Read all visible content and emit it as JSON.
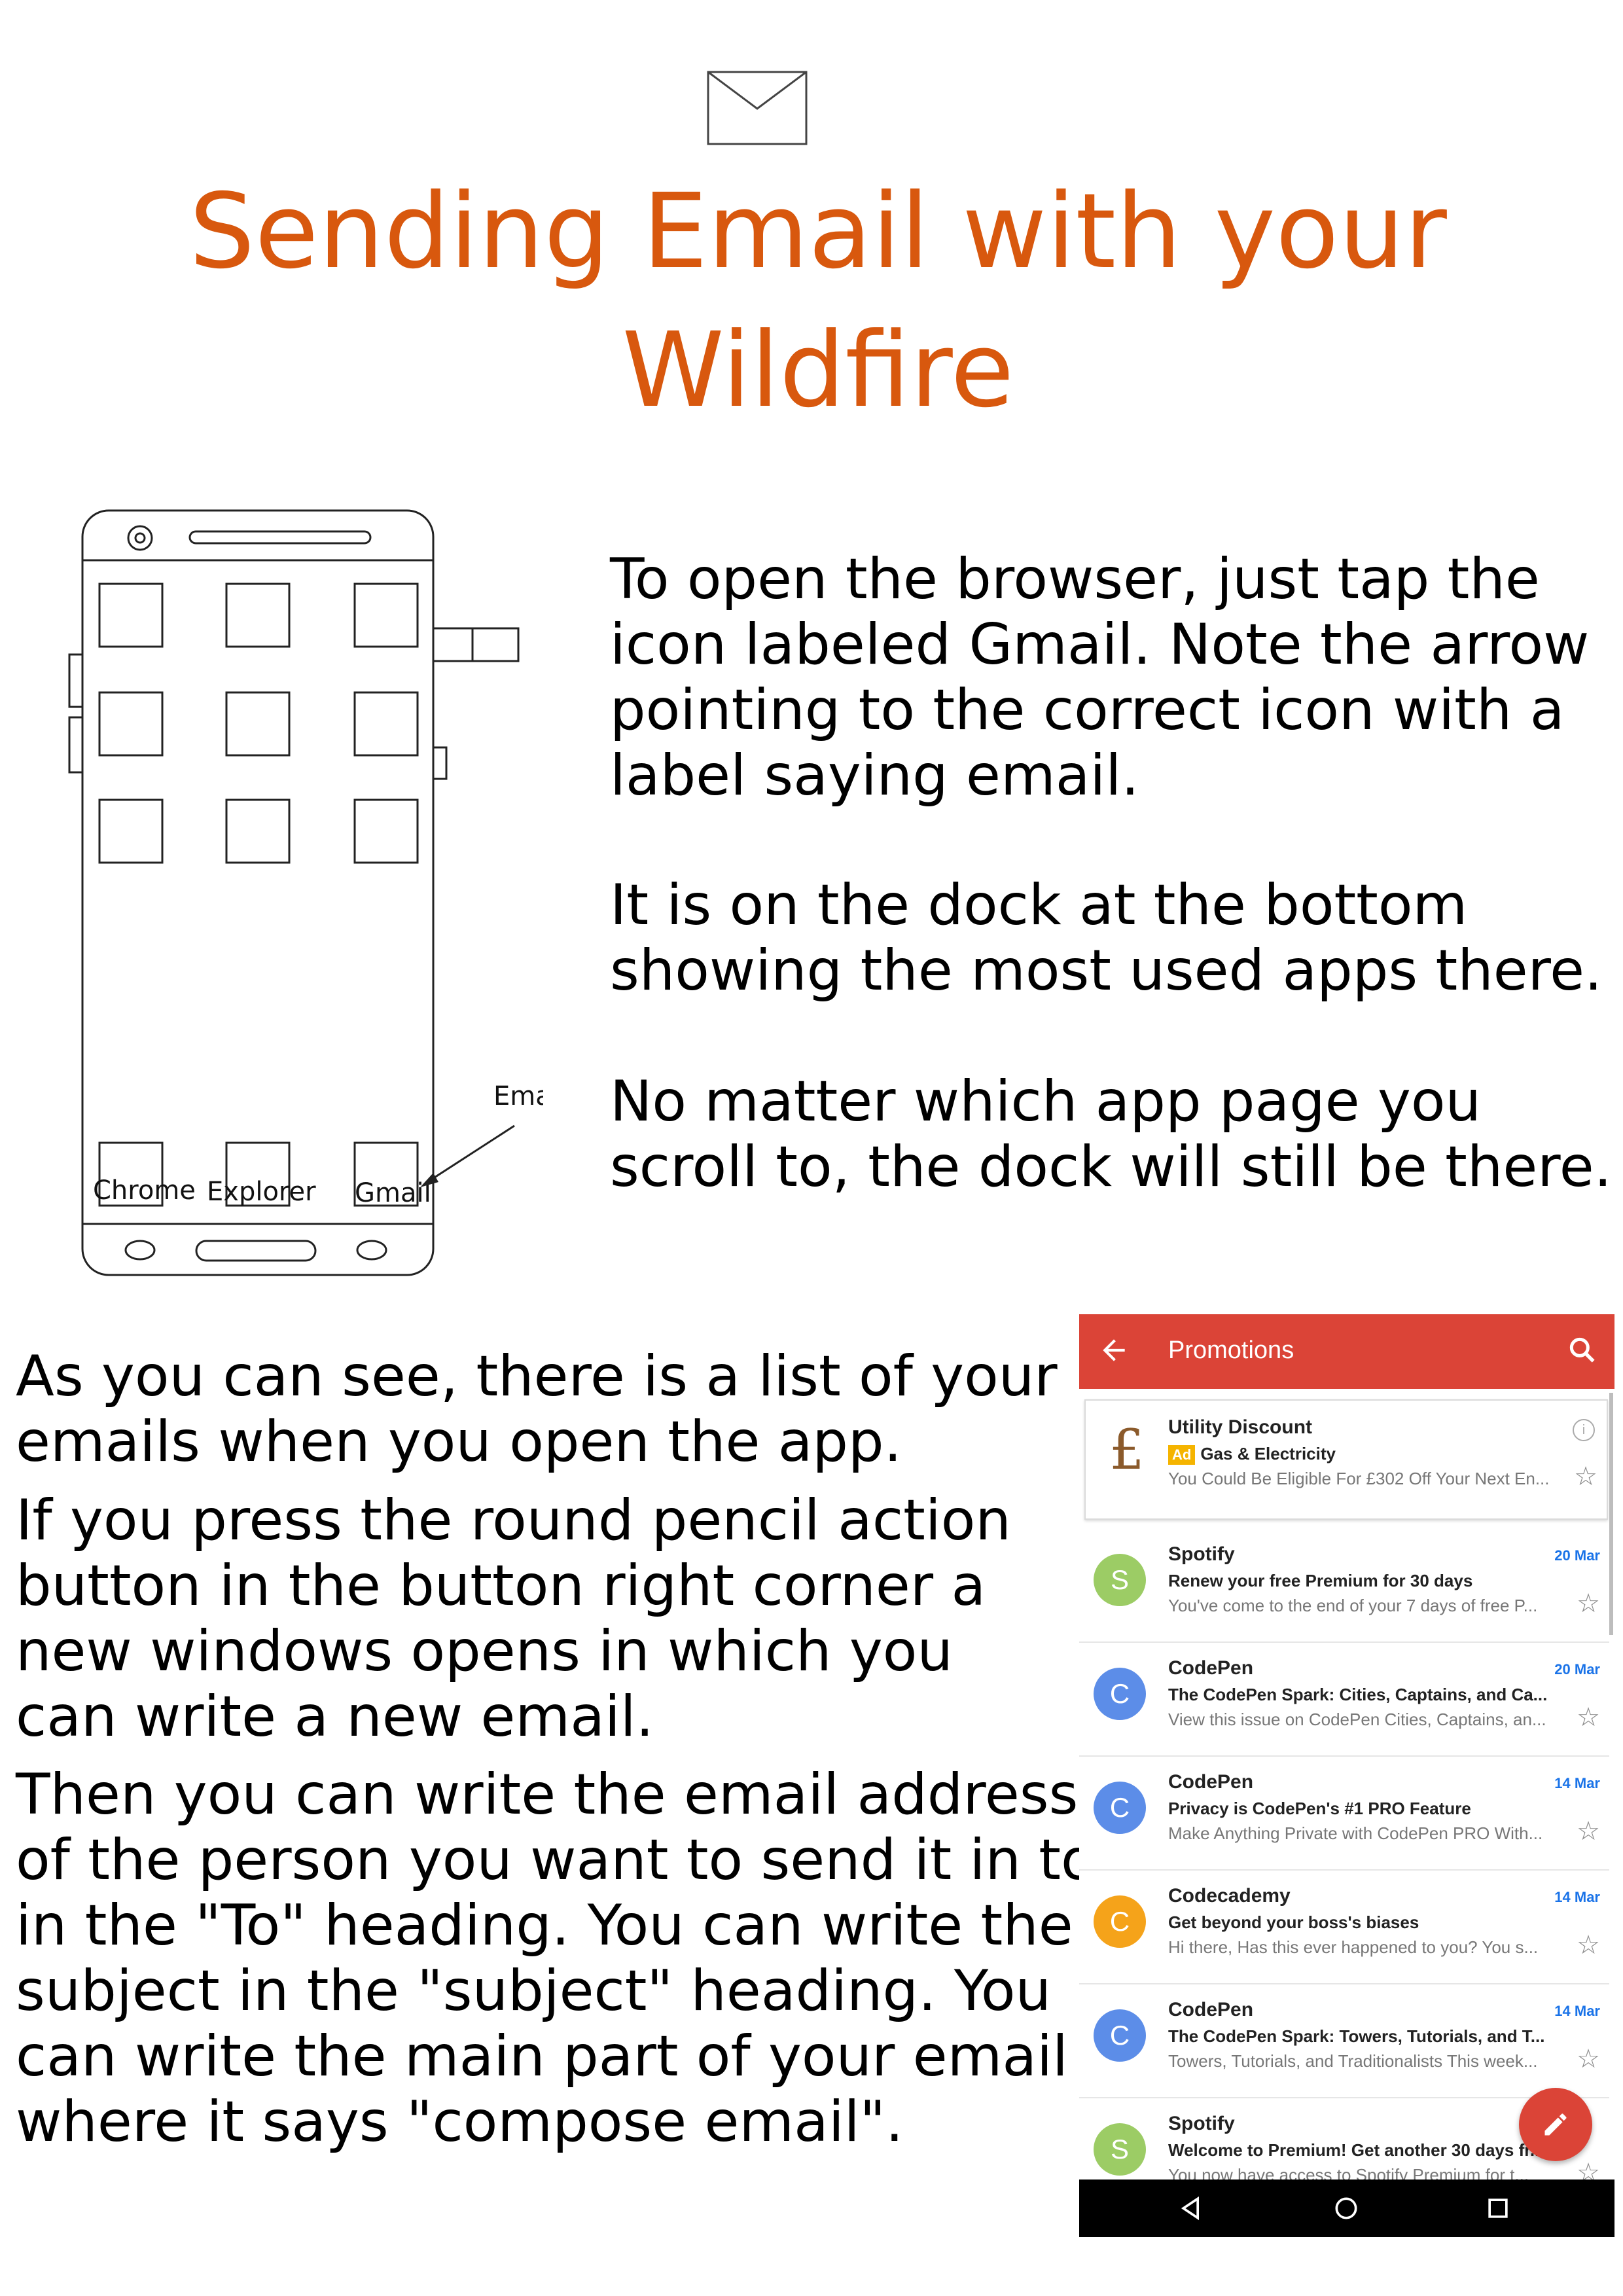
{
  "header": {
    "icon": "envelope-icon",
    "title": "Sending Email with your Wildfire",
    "title_color": "#d8580e"
  },
  "sketch": {
    "dock_labels": [
      "Chrome",
      "Explorer",
      "Gmail"
    ],
    "arrow_label": "Email"
  },
  "intro": {
    "paragraph_1": "To open the browser, just tap the icon labeled Gmail. Note the arrow pointing to the correct icon with a label saying email.",
    "paragraph_2": "It is on the dock at the bottom showing the most used apps there.",
    "paragraph_3": "No matter which app page you scroll to, the dock will still be there."
  },
  "instructions": {
    "paragraph_1": "As you can see, there is a list of your emails when you open the app.",
    "paragraph_2": "If you press the round pencil action button in the button right corner a new windows opens in which you can write a new email.",
    "paragraph_3": "Then you can write the email address of the person you want to send it in to in the \"To\" heading. You can write the subject in the \"subject\" heading. You can write the main part of your email where it says \"compose email\"."
  },
  "gmail": {
    "toolbar_title": "Promotions",
    "toolbar_color": "#db4437",
    "ad": {
      "sender": "Utility Discount",
      "ad_tag": "Ad",
      "subject": "Gas & Electricity",
      "snippet": "You Could Be Eligible For £302 Off Your Next En..."
    },
    "emails": [
      {
        "avatar": "S",
        "avatar_color": "#9ccc65",
        "sender": "Spotify",
        "date": "20 Mar",
        "subject": "Renew your free Premium for 30 days",
        "snippet": "You've come to the end of your 7 days of free P..."
      },
      {
        "avatar": "C",
        "avatar_color": "#5c8de8",
        "sender": "CodePen",
        "date": "20 Mar",
        "subject": "The CodePen Spark: Cities, Captains, and Ca...",
        "snippet": "View this issue on CodePen Cities, Captains, an..."
      },
      {
        "avatar": "C",
        "avatar_color": "#5c8de8",
        "sender": "CodePen",
        "date": "14 Mar",
        "subject": "Privacy is CodePen's #1 PRO Feature",
        "snippet": "Make Anything Private with CodePen PRO With..."
      },
      {
        "avatar": "C",
        "avatar_color": "#f5a31a",
        "sender": "Codecademy",
        "date": "14 Mar",
        "subject": "Get beyond your boss's biases",
        "snippet": "Hi there, Has this ever happened to you? You s..."
      },
      {
        "avatar": "C",
        "avatar_color": "#5c8de8",
        "sender": "CodePen",
        "date": "14 Mar",
        "subject": "The CodePen Spark: Towers, Tutorials, and T...",
        "snippet": "Towers, Tutorials, and Traditionalists This week..."
      },
      {
        "avatar": "S",
        "avatar_color": "#9ccc65",
        "sender": "Spotify",
        "date": "",
        "subject": "Welcome to Premium! Get another 30 days fr...",
        "snippet": "You now have access to Spotify Premium for t..."
      }
    ]
  }
}
